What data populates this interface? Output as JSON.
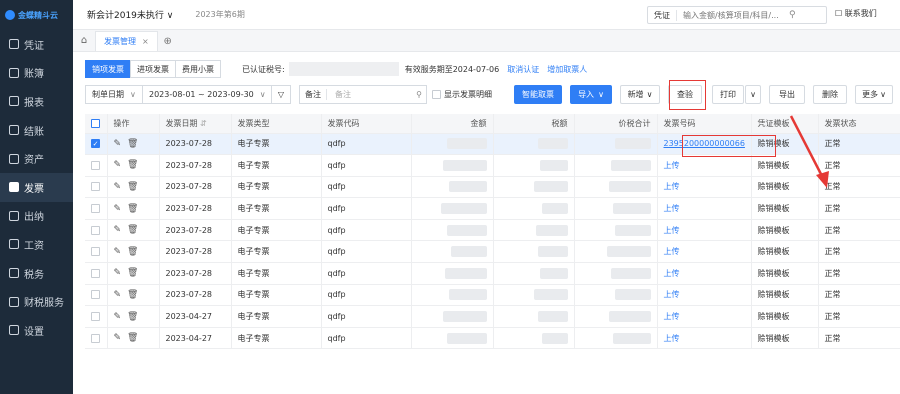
{
  "sidebar": {
    "logo": "金蝶精斗云",
    "items": [
      {
        "label": "凭证",
        "icon": "voucher-icon"
      },
      {
        "label": "账簿",
        "icon": "ledger-icon"
      },
      {
        "label": "报表",
        "icon": "report-icon"
      },
      {
        "label": "结账",
        "icon": "close-account-icon"
      },
      {
        "label": "资产",
        "icon": "asset-icon"
      },
      {
        "label": "发票",
        "icon": "invoice-icon"
      },
      {
        "label": "出纳",
        "icon": "cashier-icon"
      },
      {
        "label": "工资",
        "icon": "salary-icon"
      },
      {
        "label": "税务",
        "icon": "tax-icon"
      },
      {
        "label": "财税服务",
        "icon": "service-icon"
      },
      {
        "label": "设置",
        "icon": "settings-icon"
      }
    ]
  },
  "topbar": {
    "company": "新会计2019未执行",
    "company_caret": "∨",
    "period": "2023年第6期",
    "search_category": "凭证",
    "search_placeholder": "输入金额/核算项目/科目/...",
    "contact": "联系我们"
  },
  "tabs": {
    "home": "⌂",
    "active": "发票管理",
    "close": "×",
    "add": "⊕"
  },
  "toolbar1": {
    "seg_sales": "销项发票",
    "seg_input": "进项发票",
    "seg_small": "费用小票",
    "tax_label": "已认证税号:",
    "valid": "有效服务期至2024-07-06",
    "cancel_auth": "取消认证",
    "add_taker": "增加取票人"
  },
  "toolbar2": {
    "date_type": "制单日期",
    "date_range": "2023-08-01 ~ 2023-09-30",
    "filter_icon": "▽",
    "memo_field": "备注",
    "memo_placeholder": "备注",
    "show_detail": "显示发票明细",
    "smart_fetch": "智能取票",
    "import": "导入",
    "add": "新增",
    "check": "查验",
    "print": "打印",
    "export": "导出",
    "delete": "删除",
    "more": "更多"
  },
  "table": {
    "headers": [
      "操作",
      "发票日期",
      "发票类型",
      "发票代码",
      "金额",
      "税额",
      "价税合计",
      "发票号码",
      "凭证模板",
      "发票状态"
    ],
    "rows": [
      {
        "date": "2023-07-28",
        "type": "电子专票",
        "code": "qdfp",
        "no": "2395200000000066",
        "tpl": "赊销模板",
        "status": "正常",
        "selected": true
      },
      {
        "date": "2023-07-28",
        "type": "电子专票",
        "code": "qdfp",
        "no": "上传",
        "tpl": "赊销模板",
        "status": "正常"
      },
      {
        "date": "2023-07-28",
        "type": "电子专票",
        "code": "qdfp",
        "no": "上传",
        "tpl": "赊销模板",
        "status": "正常"
      },
      {
        "date": "2023-07-28",
        "type": "电子专票",
        "code": "qdfp",
        "no": "上传",
        "tpl": "赊销模板",
        "status": "正常"
      },
      {
        "date": "2023-07-28",
        "type": "电子专票",
        "code": "qdfp",
        "no": "上传",
        "tpl": "赊销模板",
        "status": "正常"
      },
      {
        "date": "2023-07-28",
        "type": "电子专票",
        "code": "qdfp",
        "no": "上传",
        "tpl": "赊销模板",
        "status": "正常"
      },
      {
        "date": "2023-07-28",
        "type": "电子专票",
        "code": "qdfp",
        "no": "上传",
        "tpl": "赊销模板",
        "status": "正常"
      },
      {
        "date": "2023-07-28",
        "type": "电子专票",
        "code": "qdfp",
        "no": "上传",
        "tpl": "赊销模板",
        "status": "正常"
      },
      {
        "date": "2023-04-27",
        "type": "电子专票",
        "code": "qdfp",
        "no": "上传",
        "tpl": "赊销模板",
        "status": "正常"
      },
      {
        "date": "2023-04-27",
        "type": "电子专票",
        "code": "qdfp",
        "no": "上传",
        "tpl": "赊销模板",
        "status": "正常"
      }
    ]
  },
  "colors": {
    "accent": "#2f7ef5",
    "sidebar": "#1d2b3a",
    "highlight": "#e53935"
  }
}
